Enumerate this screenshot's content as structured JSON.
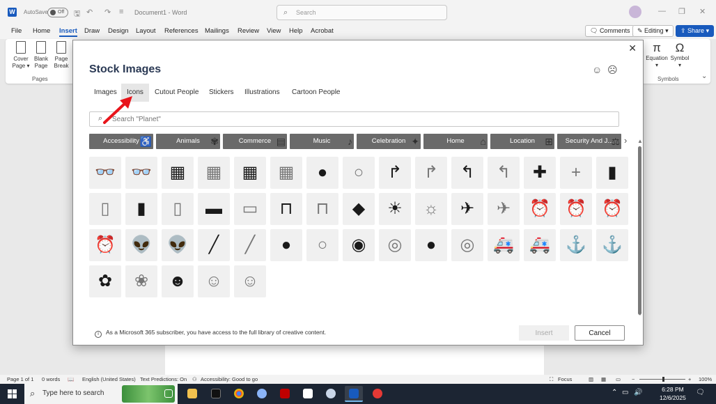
{
  "window": {
    "app_logo": "W",
    "autosave_label": "AutoSave",
    "autosave_state": "Off",
    "doc_title": "Document1  -  Word",
    "search_placeholder": "Search"
  },
  "menu": {
    "items": [
      "File",
      "Home",
      "Insert",
      "Draw",
      "Design",
      "Layout",
      "References",
      "Mailings",
      "Review",
      "View",
      "Help",
      "Acrobat"
    ],
    "active": "Insert",
    "comments_label": "Comments",
    "editing_label": "Editing",
    "share_label": "Share"
  },
  "ribbon": {
    "cover_page": "Cover Page",
    "blank_page": "Blank Page",
    "page_break": "Page Break",
    "pages_group": "Pages",
    "equation": "Equation",
    "symbol": "Symbol",
    "symbols_group": "Symbols",
    "equation_glyph": "π",
    "symbol_glyph": "Ω"
  },
  "dialog": {
    "title": "Stock Images",
    "tabs": [
      "Images",
      "Icons",
      "Cutout People",
      "Stickers",
      "Illustrations",
      "Cartoon People"
    ],
    "active_tab": "Icons",
    "search_placeholder": "Search \"Planet\"",
    "categories": [
      "Accessibility",
      "Animals",
      "Commerce",
      "Music",
      "Celebration",
      "Home",
      "Location",
      "Security And J..."
    ],
    "info": "As a Microsoft 365 subscriber, you have access to the full library of creative content.",
    "insert_label": "Insert",
    "cancel_label": "Cancel"
  },
  "icons": [
    {
      "name": "3d-glasses-icon",
      "glyph": "👓",
      "style": "filled"
    },
    {
      "name": "3d-glasses-outline-icon",
      "glyph": "👓",
      "style": "outline"
    },
    {
      "name": "abacus-icon",
      "glyph": "▦",
      "style": "filled"
    },
    {
      "name": "abacus-outline-icon",
      "glyph": "▦",
      "style": "outline"
    },
    {
      "name": "abacus-wide-icon",
      "glyph": "▦",
      "style": "filled"
    },
    {
      "name": "abacus-wide-outline-icon",
      "glyph": "▦",
      "style": "outline"
    },
    {
      "name": "acorn-icon",
      "glyph": "●",
      "style": "filled"
    },
    {
      "name": "acorn-outline-icon",
      "glyph": "○",
      "style": "outline"
    },
    {
      "name": "curved-arrow-right-icon",
      "glyph": "↱",
      "style": "filled"
    },
    {
      "name": "curved-arrow-right-outline-icon",
      "glyph": "↱",
      "style": "outline"
    },
    {
      "name": "curved-arrow-left-icon",
      "glyph": "↰",
      "style": "filled"
    },
    {
      "name": "curved-arrow-left-outline-icon",
      "glyph": "↰",
      "style": "outline"
    },
    {
      "name": "plus-icon",
      "glyph": "✚",
      "style": "filled"
    },
    {
      "name": "plus-outline-icon",
      "glyph": "+",
      "style": "outline"
    },
    {
      "name": "address-book-icon",
      "glyph": "▮",
      "style": "filled"
    },
    {
      "name": "address-book-outline-icon",
      "glyph": "▯",
      "style": "outline"
    },
    {
      "name": "address-book-dark-icon",
      "glyph": "▮",
      "style": "filled"
    },
    {
      "name": "address-book-light-icon",
      "glyph": "▯",
      "style": "outline"
    },
    {
      "name": "bandage-icon",
      "glyph": "▬",
      "style": "filled"
    },
    {
      "name": "bandage-outline-icon",
      "glyph": "▭",
      "style": "outline"
    },
    {
      "name": "billboard-icon",
      "glyph": "⊓",
      "style": "filled"
    },
    {
      "name": "billboard-outline-icon",
      "glyph": "⊓",
      "style": "outline"
    },
    {
      "name": "africa-icon",
      "glyph": "◆",
      "style": "filled"
    },
    {
      "name": "agriculture-icon",
      "glyph": "☀",
      "style": "filled"
    },
    {
      "name": "agriculture-outline-icon",
      "glyph": "☼",
      "style": "outline"
    },
    {
      "name": "airplane-icon",
      "glyph": "✈",
      "style": "filled"
    },
    {
      "name": "airplane-outline-icon",
      "glyph": "✈",
      "style": "outline"
    },
    {
      "name": "alarm-clock-icon",
      "glyph": "⏰",
      "style": "filled"
    },
    {
      "name": "alarm-clock-outline-icon",
      "glyph": "⏰",
      "style": "outline"
    },
    {
      "name": "alarm-ringing-icon",
      "glyph": "⏰",
      "style": "filled"
    },
    {
      "name": "alarm-ringing-outline-icon",
      "glyph": "⏰",
      "style": "outline"
    },
    {
      "name": "alien-icon",
      "glyph": "👽",
      "style": "filled"
    },
    {
      "name": "alien-outline-icon",
      "glyph": "👽",
      "style": "outline"
    },
    {
      "name": "needle-thread-icon",
      "glyph": "╱",
      "style": "filled"
    },
    {
      "name": "needle-thread-outline-icon",
      "glyph": "╱",
      "style": "outline"
    },
    {
      "name": "yarn-ball-icon",
      "glyph": "●",
      "style": "filled"
    },
    {
      "name": "yarn-ball-outline-icon",
      "glyph": "○",
      "style": "outline"
    },
    {
      "name": "measuring-tape-icon",
      "glyph": "◉",
      "style": "filled"
    },
    {
      "name": "measuring-tape-outline-icon",
      "glyph": "◎",
      "style": "outline"
    },
    {
      "name": "button-icon",
      "glyph": "●",
      "style": "filled"
    },
    {
      "name": "button-outline-icon",
      "glyph": "◎",
      "style": "outline"
    },
    {
      "name": "ambulance-icon",
      "glyph": "🚑",
      "style": "filled"
    },
    {
      "name": "ambulance-outline-icon",
      "glyph": "🚑",
      "style": "outline"
    },
    {
      "name": "anchor-icon",
      "glyph": "⚓",
      "style": "filled"
    },
    {
      "name": "anchor-outline-icon",
      "glyph": "⚓",
      "style": "outline"
    },
    {
      "name": "coral-fish-icon",
      "glyph": "✿",
      "style": "filled"
    },
    {
      "name": "coral-fish-outline-icon",
      "glyph": "❀",
      "style": "outline"
    },
    {
      "name": "angel-face-icon",
      "glyph": "☻",
      "style": "filled"
    },
    {
      "name": "angel-face-outline-icon",
      "glyph": "☺",
      "style": "outline"
    },
    {
      "name": "angel-face-smile-icon",
      "glyph": "☺",
      "style": "outline"
    }
  ],
  "statusbar": {
    "page": "Page 1 of 1",
    "words": "0 words",
    "language": "English (United States)",
    "predictions": "Text Predictions: On",
    "accessibility": "Accessibility: Good to go",
    "focus": "Focus",
    "zoom": "100%"
  },
  "taskbar": {
    "search_text": "Type here to search",
    "time": "6:28 PM",
    "date": "12/6/2025"
  }
}
